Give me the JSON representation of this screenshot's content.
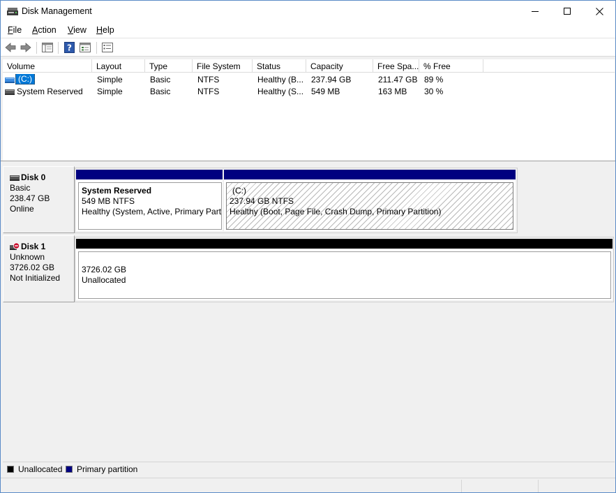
{
  "window": {
    "title": "Disk Management",
    "controls": [
      "minimize",
      "maximize",
      "close"
    ]
  },
  "menu": [
    {
      "label": "File",
      "access": "F",
      "rest": "ile"
    },
    {
      "label": "Action",
      "access": "A",
      "rest": "ction"
    },
    {
      "label": "View",
      "access": "V",
      "rest": "iew"
    },
    {
      "label": "Help",
      "access": "H",
      "rest": "elp"
    }
  ],
  "toolbar": {
    "icons": [
      "back-arrow-icon",
      "forward-arrow-icon",
      "console-tree-icon",
      "help-icon",
      "list-view-icon",
      "properties-icon"
    ]
  },
  "volume_table": {
    "columns": [
      "Volume",
      "Layout",
      "Type",
      "File System",
      "Status",
      "Capacity",
      "Free Spa...",
      "% Free"
    ],
    "rows": [
      {
        "volume": "(C:)",
        "layout": "Simple",
        "type": "Basic",
        "fs": "NTFS",
        "status": "Healthy (B...",
        "capacity": "237.94 GB",
        "free": "211.47 GB",
        "pct": "89 %",
        "selected": true
      },
      {
        "volume": "System Reserved",
        "layout": "Simple",
        "type": "Basic",
        "fs": "NTFS",
        "status": "Healthy (S...",
        "capacity": "549 MB",
        "free": "163 MB",
        "pct": "30 %",
        "selected": false
      }
    ]
  },
  "disks": [
    {
      "name": "Disk 0",
      "kind": "Basic",
      "size": "238.47 GB",
      "state": "Online",
      "partitions": [
        {
          "title": "System Reserved",
          "line1": "549 MB NTFS",
          "line2": "Healthy (System, Active, Primary Part"
        },
        {
          "title": "(C:)",
          "line1": "237.94 GB NTFS",
          "line2": "Healthy (Boot, Page File, Crash Dump, Primary Partition)"
        }
      ]
    },
    {
      "name": "Disk 1",
      "kind": "Unknown",
      "size": "3726.02 GB",
      "state": "Not Initialized",
      "partitions": [
        {
          "line1": "3726.02 GB",
          "line2": "Unallocated"
        }
      ]
    }
  ],
  "legend": [
    {
      "label": "Unallocated",
      "color": "#000000"
    },
    {
      "label": "Primary partition",
      "color": "#000080"
    }
  ],
  "colors": {
    "primary_partition": "#000080",
    "unallocated": "#000000",
    "selection": "#0078d7"
  }
}
